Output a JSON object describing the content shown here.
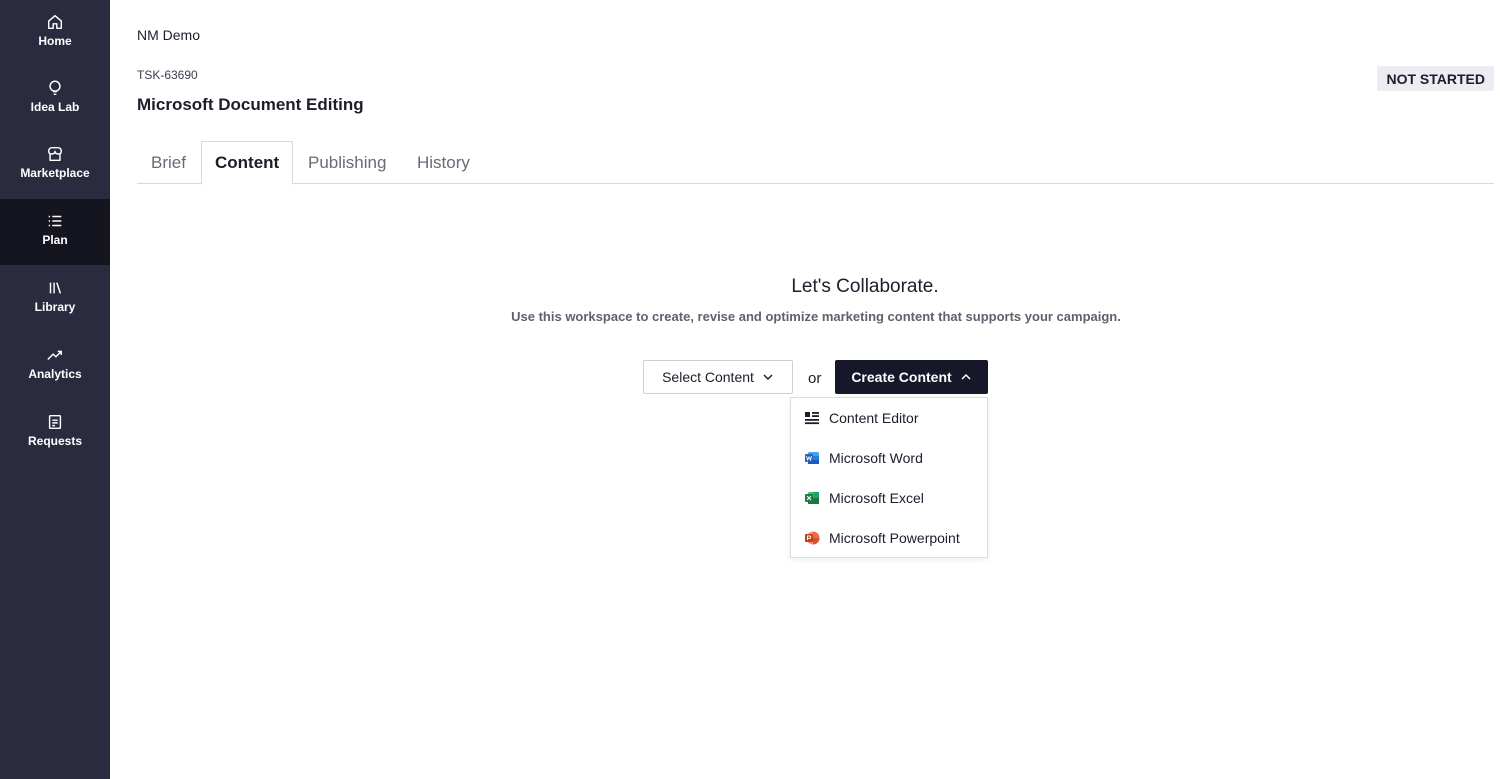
{
  "sidebar": {
    "items": [
      {
        "label": "Home",
        "icon": "home-icon"
      },
      {
        "label": "Idea Lab",
        "icon": "lightbulb-icon"
      },
      {
        "label": "Marketplace",
        "icon": "store-icon"
      },
      {
        "label": "Plan",
        "icon": "list-icon"
      },
      {
        "label": "Library",
        "icon": "library-icon"
      },
      {
        "label": "Analytics",
        "icon": "trend-icon"
      },
      {
        "label": "Requests",
        "icon": "document-icon"
      }
    ],
    "active": "Plan"
  },
  "header": {
    "workspace": "NM Demo",
    "task_id": "TSK-63690",
    "title": "Microsoft Document Editing",
    "status": "NOT STARTED"
  },
  "tabs": [
    {
      "label": "Brief"
    },
    {
      "label": "Content"
    },
    {
      "label": "Publishing"
    },
    {
      "label": "History"
    }
  ],
  "active_tab": "Content",
  "main": {
    "title": "Let's Collaborate.",
    "subtitle": "Use this workspace to create, revise and optimize marketing content that supports your campaign.",
    "select_label": "Select Content",
    "or_label": "or",
    "create_label": "Create Content"
  },
  "dropdown": {
    "items": [
      {
        "label": "Content Editor",
        "icon": "content-editor-icon"
      },
      {
        "label": "Microsoft Word",
        "icon": "word-icon"
      },
      {
        "label": "Microsoft Excel",
        "icon": "excel-icon"
      },
      {
        "label": "Microsoft Powerpoint",
        "icon": "powerpoint-icon"
      }
    ]
  },
  "colors": {
    "sidebar_bg": "#2b2b40",
    "sidebar_active": "#15151f",
    "primary_button": "#17172a",
    "word": "#2b5fb8",
    "excel": "#1f7a43",
    "powerpoint": "#d8512b"
  }
}
